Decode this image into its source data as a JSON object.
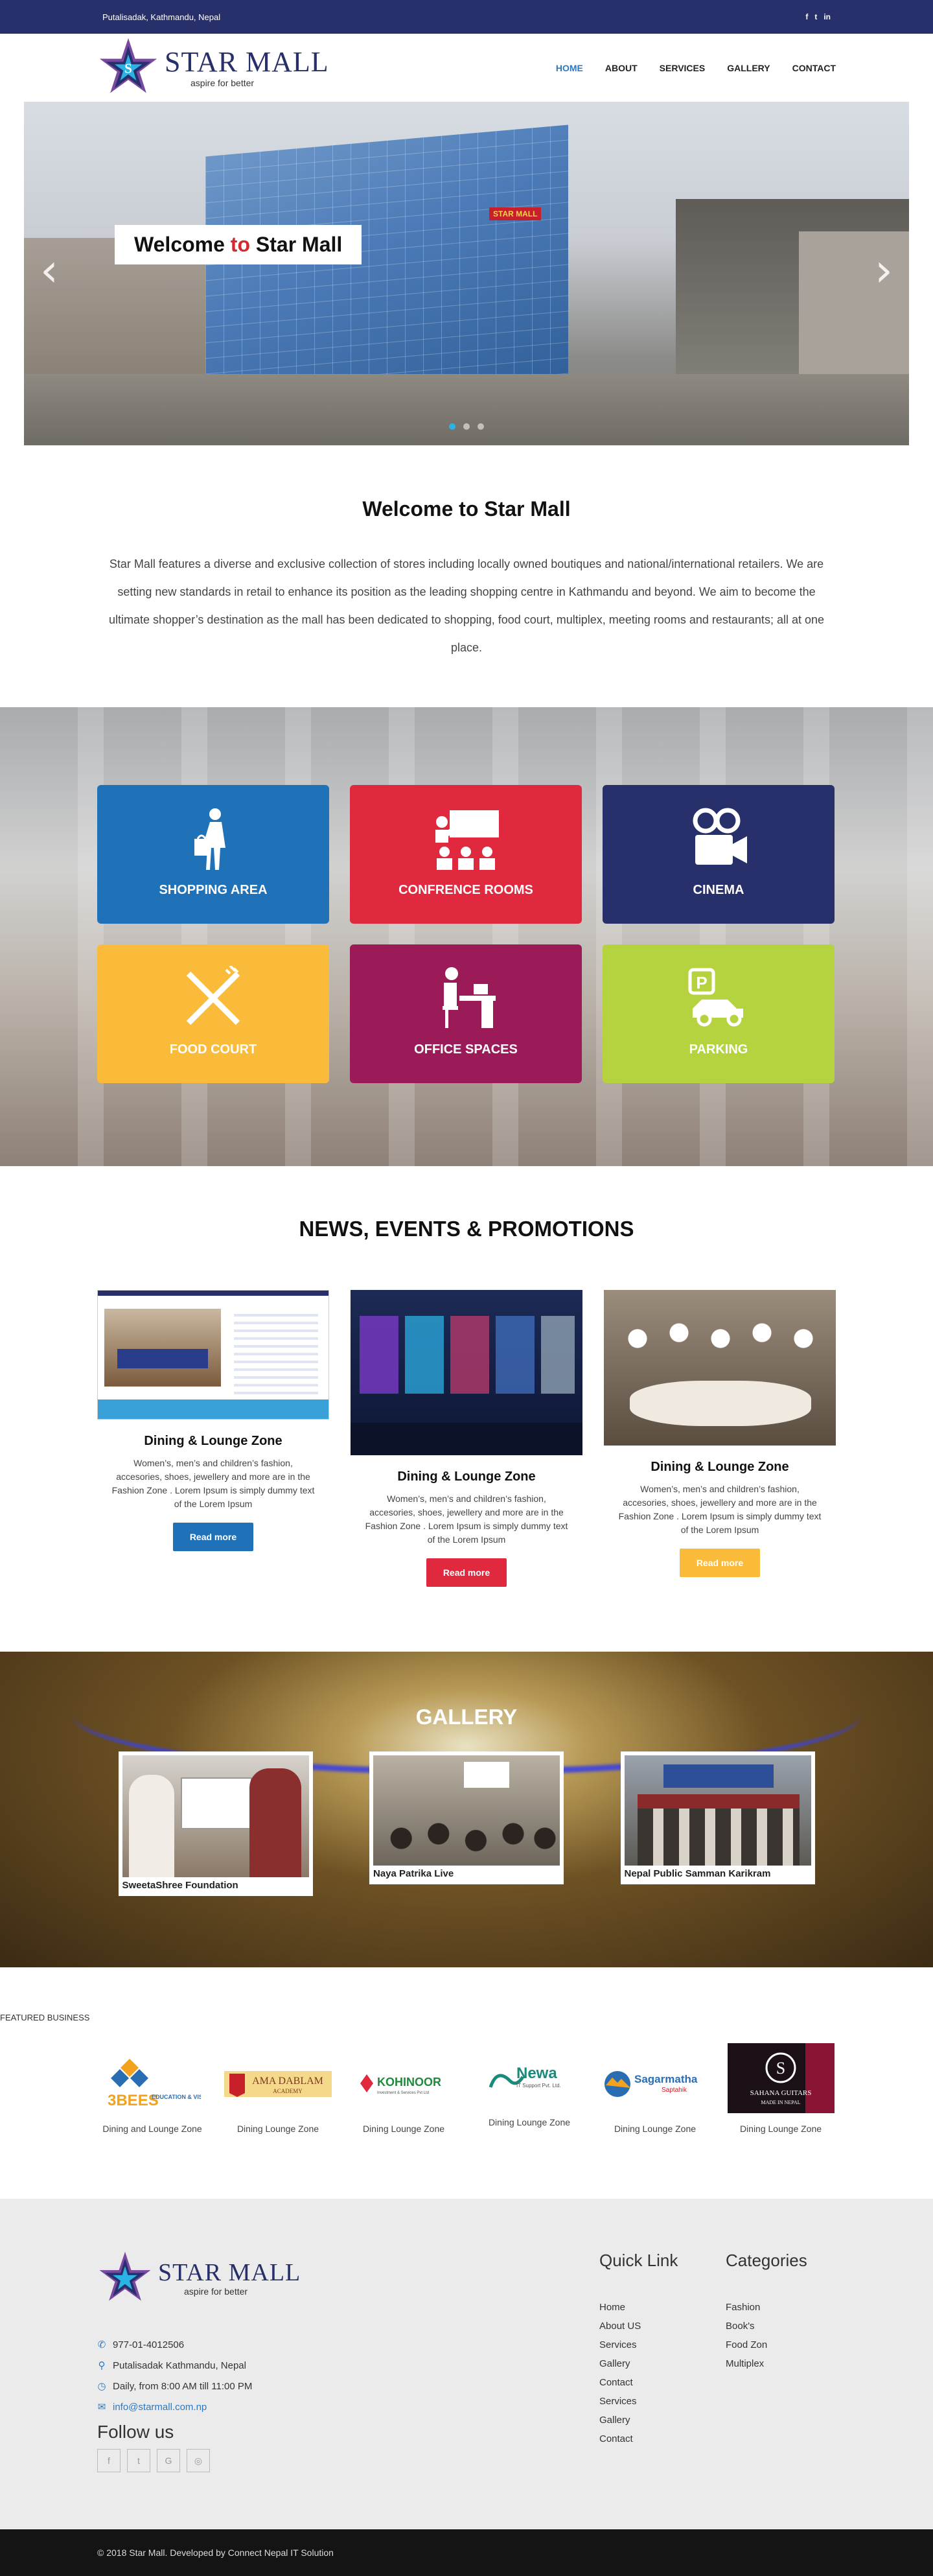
{
  "topbar": {
    "address": "Putalisadak, Kathmandu, Nepal",
    "social": [
      "f",
      "t",
      "in"
    ]
  },
  "logo": {
    "name": "STAR MALL",
    "tagline": "aspire for better"
  },
  "nav": {
    "items": [
      "HOME",
      "ABOUT",
      "SERVICES",
      "GALLERY",
      "CONTACT"
    ],
    "active": "HOME"
  },
  "hero": {
    "title_a": "Welcome ",
    "title_b": "to",
    "title_c": " Star Mall",
    "sign": "STAR MALL"
  },
  "intro": {
    "title": "Welcome to Star Mall",
    "text": "Star Mall features a diverse and exclusive collection of stores including locally owned boutiques and national/international retailers. We are setting new standards in retail to enhance its position as the leading shopping centre in Kathmandu and beyond. We aim to become the ultimate shopper’s destination as the mall has been dedicated to shopping, food court, multiplex, meeting rooms and restaurants; all at one place."
  },
  "services": [
    {
      "label": "SHOPPING AREA",
      "color": "#1f71b8",
      "icon": "shopping-bag-icon"
    },
    {
      "label": "CONFRENCE ROOMS",
      "color": "#e0283e",
      "icon": "conference-icon"
    },
    {
      "label": "CINEMA",
      "color": "#28306b",
      "icon": "film-camera-icon"
    },
    {
      "label": "FOOD COURT",
      "color": "#fbbb3a",
      "icon": "fork-knife-icon"
    },
    {
      "label": "OFFICE SPACES",
      "color": "#9b1b59",
      "icon": "office-icon"
    },
    {
      "label": "PARKING",
      "color": "#b4d33f",
      "icon": "parking-icon"
    }
  ],
  "news": {
    "title": "NEWS, EVENTS & PROMOTIONS",
    "cards": [
      {
        "title": "Dining & Lounge Zone",
        "text": "Women’s, men’s and children’s fashion, accesories, shoes, jewellery and more are in the Fashion Zone . Lorem Ipsum is simply dummy text of the Lorem Ipsum",
        "button": "Read more",
        "btn_color": "#1f71b8"
      },
      {
        "title": "Dining & Lounge Zone",
        "text": "Women’s, men’s and children’s fashion, accesories, shoes, jewellery and more are in the Fashion Zone . Lorem Ipsum is simply dummy text of the Lorem Ipsum",
        "button": "Read more",
        "btn_color": "#e0283e"
      },
      {
        "title": "Dining & Lounge Zone",
        "text": "Women’s, men’s and children’s fashion, accesories, shoes, jewellery and more are in the Fashion Zone . Lorem Ipsum is simply dummy text of the Lorem Ipsum",
        "button": "Read more",
        "btn_color": "#fbbb3a"
      }
    ]
  },
  "gallery": {
    "title": "GALLERY",
    "items": [
      {
        "caption": "SweetaShree Foundation"
      },
      {
        "caption": "Naya Patrika Live"
      },
      {
        "caption": "Nepal Public Samman Karikram"
      }
    ]
  },
  "featured": {
    "label": "FEATURED BUSINESS",
    "items": [
      {
        "name": "3BEES",
        "sub": "EDUCATION & VISA SERVICES",
        "caption": "Dining and Lounge Zone"
      },
      {
        "name": "AMA DABLAM",
        "sub": "ACADEMY",
        "caption": "Dining Lounge Zone"
      },
      {
        "name": "KOHINOOR",
        "sub": "Investment & Services Pvt Ltd",
        "caption": "Dining Lounge Zone"
      },
      {
        "name": "Newa",
        "sub": "IT Support Pvt. Ltd.",
        "caption": "Dining Lounge Zone"
      },
      {
        "name": "Sagarmatha",
        "sub": "Saptahik",
        "caption": "Dining Lounge Zone"
      },
      {
        "name": "SAHANA GUITARS",
        "sub": "MADE IN NEPAL",
        "caption": "Dining Lounge Zone"
      }
    ]
  },
  "footer": {
    "phone": "977-01-4012506",
    "address": "Putalisadak Kathmandu, Nepal",
    "hours": "Daily, from 8:00 AM till 11:00 PM",
    "email": "info@starmall.com.np",
    "follow": "Follow us",
    "social": [
      "f",
      "t",
      "G",
      "◎"
    ],
    "quick_title": "Quick Link",
    "quick_links": [
      "Home",
      "About US",
      "Services",
      "Gallery",
      "Contact",
      "Services",
      "Gallery",
      "Contact"
    ],
    "cat_title": "Categories",
    "categories": [
      "Fashion",
      "Book's",
      "Food Zon",
      "Multiplex"
    ],
    "copyright": "© 2018 Star Mall. Developed by Connect Nepal IT Solution"
  }
}
